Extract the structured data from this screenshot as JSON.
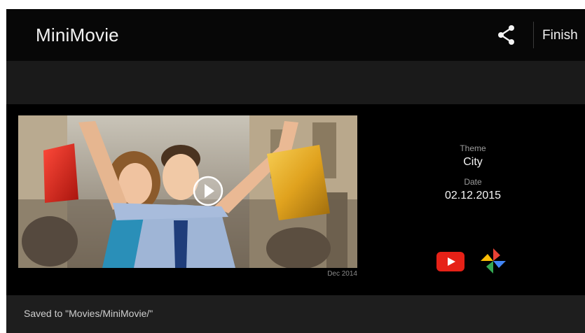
{
  "app": {
    "title": "MiniMovie"
  },
  "toolbar": {
    "share_icon": "share-icon",
    "finish_label": "Finish"
  },
  "video": {
    "thumbnail": "couple-with-shopping-bags-photo",
    "play_icon": "play-icon",
    "date_caption": "Dec 2014"
  },
  "details": {
    "theme_label": "Theme",
    "theme_value": "City",
    "date_label": "Date",
    "date_value": "02.12.2015"
  },
  "share_targets": [
    {
      "name": "YouTube",
      "icon": "youtube-icon",
      "color": "#e62117"
    },
    {
      "name": "Photos",
      "icon": "photos-pinwheel-icon"
    }
  ],
  "status": {
    "saved_text": "Saved to \"Movies/MiniMovie/\""
  },
  "colors": {
    "background": "#000000",
    "appbar": "#070707",
    "subbar": "#1a1a1a",
    "footer": "#1e1e1e"
  }
}
